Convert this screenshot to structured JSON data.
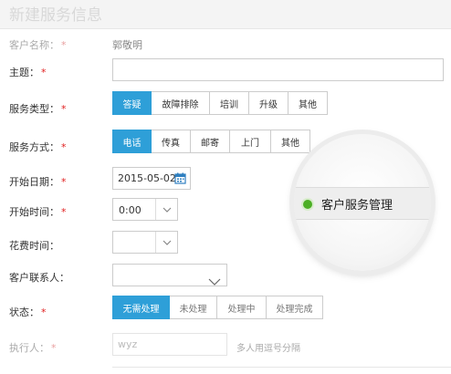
{
  "header": {
    "title": "新建服务信息"
  },
  "customer": {
    "label": "客户名称：",
    "value": "郭敬明"
  },
  "subject": {
    "label": "主题：",
    "value": ""
  },
  "service_type": {
    "label": "服务类型：",
    "options": [
      "答疑",
      "故障排除",
      "培训",
      "升级",
      "其他"
    ],
    "selected": "答疑"
  },
  "service_method": {
    "label": "服务方式：",
    "options": [
      "电话",
      "传真",
      "邮寄",
      "上门",
      "其他"
    ],
    "selected": "电话"
  },
  "start_date": {
    "label": "开始日期：",
    "value": "2015-05-02"
  },
  "start_time": {
    "label": "开始时间：",
    "value": "0:00"
  },
  "spent_time": {
    "label": "花费时间：",
    "value": ""
  },
  "contact": {
    "label": "客户联系人：",
    "value": ""
  },
  "status": {
    "label": "状态：",
    "options": [
      "无需处理",
      "未处理",
      "处理中",
      "处理完成"
    ],
    "selected": "无需处理"
  },
  "executor": {
    "label": "执行人：",
    "value": "wyz",
    "hint": "多人用逗号分隔"
  },
  "magnifier": {
    "text": "客户服务管理",
    "dot_color": "#4caf25"
  },
  "colors": {
    "accent": "#2e9fd8",
    "required": "#e02020"
  }
}
